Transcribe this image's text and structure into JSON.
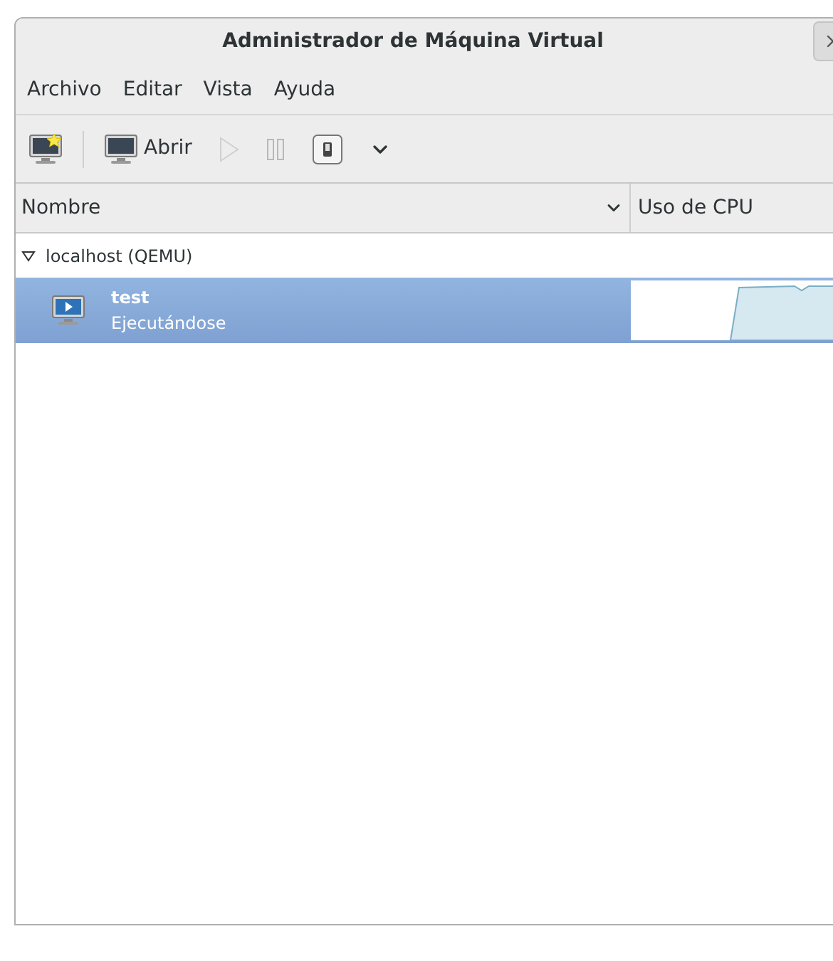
{
  "window": {
    "title": "Administrador de Máquina Virtual"
  },
  "menu": [
    "Archivo",
    "Editar",
    "Vista",
    "Ayuda"
  ],
  "toolbar": [
    {
      "kind": "new",
      "disabled": false
    },
    {
      "kind": "open",
      "label": "Abrir",
      "disabled": false
    },
    {
      "kind": "run",
      "disabled": true
    },
    {
      "kind": "pause",
      "disabled": true
    },
    {
      "kind": "shutdown",
      "disabled": false
    },
    {
      "kind": "menu",
      "disabled": false
    }
  ],
  "table": {
    "columns": [
      "Nombre",
      "Uso de CPU"
    ],
    "rows": [
      {
        "name": "localhost (QEMU)",
        "expanded": true,
        "children": [
          {
            "name": "test",
            "status": "Ejecutándose",
            "selected": true
          }
        ]
      }
    ]
  }
}
